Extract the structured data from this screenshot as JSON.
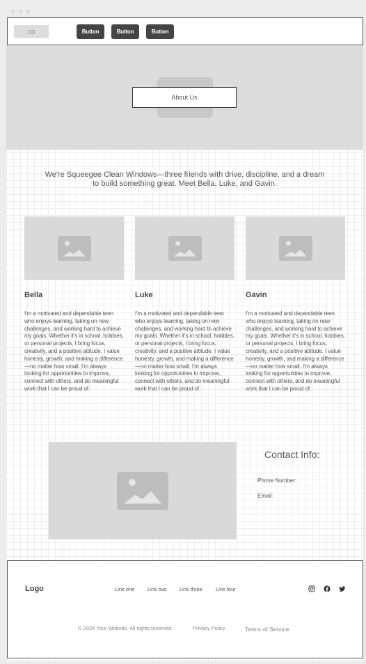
{
  "nav": {
    "buttons": [
      "Button",
      "Button",
      "Button"
    ]
  },
  "hero": {
    "title": "About Us"
  },
  "intro": {
    "text": "We're Squeegee Clean Windows—three friends with drive, discipline, and a dream to build something great. Meet Bella, Luke, and Gavin."
  },
  "team": [
    {
      "name": "Bella",
      "bio": "I'm a motivated and dependable teen who enjoys learning, taking on new challenges, and working hard to achieve my goals. Whether it's in school, hobbies, or personal projects, I bring focus, creativity, and a positive attitude. I value honesty, growth, and making a difference—no matter how small. I'm always looking for opportunities to improve, connect with others, and do meaningful work that I can be proud of."
    },
    {
      "name": "Luke",
      "bio": "I'm a motivated and dependable teen who enjoys learning, taking on new challenges, and working hard to achieve my goals. Whether it's in school, hobbies, or personal projects, I bring focus, creativity, and a positive attitude. I value honesty, growth, and making a difference—no matter how small. I'm always looking for opportunities to improve, connect with others, and do meaningful work that I can be proud of."
    },
    {
      "name": "Gavin",
      "bio": "I'm a motivated and dependable teen who enjoys learning, taking on new challenges, and working hard to achieve my goals. Whether it's in school, hobbies, or personal projects, I bring focus, creativity, and a positive attitude. I value honesty, growth, and making a difference—no matter how small. I'm always looking for opportunities to improve, connect with others, and do meaningful work that I can be proud of."
    }
  ],
  "contact": {
    "title": "Contact Info:",
    "phone_label": "Phone Number:",
    "email_label": "Email:"
  },
  "footer": {
    "logo": "Logo",
    "links": [
      "Link one",
      "Link two",
      "Link three",
      "Link four"
    ],
    "social_icons": [
      "instagram-icon",
      "facebook-icon",
      "twitter-icon"
    ],
    "copyright": "© 2024 Your Website. All rights reserved.",
    "privacy": "Privacy Policy",
    "terms": "Terms of Service"
  }
}
